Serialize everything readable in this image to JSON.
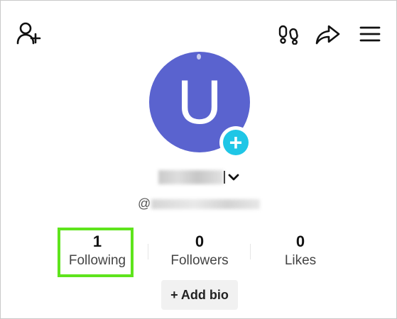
{
  "header": {
    "icons": [
      "add-friend-icon",
      "footprints-icon",
      "share-icon",
      "menu-icon"
    ]
  },
  "profile": {
    "avatar_letter": "U",
    "avatar_color": "#5a63cf",
    "badge_color": "#1fc6e6",
    "badge_symbol": "+",
    "username_chevron": "⌄",
    "handle_prefix": "@"
  },
  "stats": [
    {
      "value": "1",
      "label": "Following"
    },
    {
      "value": "0",
      "label": "Followers"
    },
    {
      "value": "0",
      "label": "Likes"
    }
  ],
  "highlight_color": "#5ee41c",
  "actions": {
    "add_bio_label": "+ Add bio"
  }
}
